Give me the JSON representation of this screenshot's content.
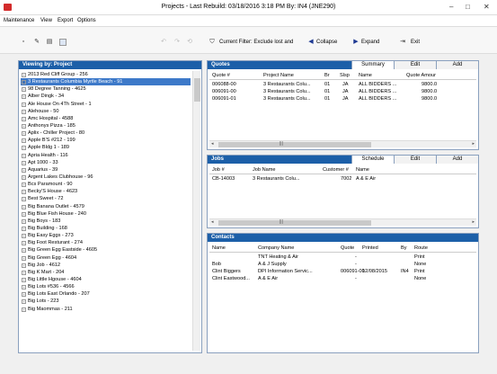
{
  "window": {
    "title": "Projects - Last Rebuild: 03/18/2016 3:18 PM By: IN4 (JNE290)",
    "minimize": "–",
    "maximize": "□",
    "close": "✕"
  },
  "menu": [
    "Maintenance",
    "View",
    "Export",
    "Options"
  ],
  "toolbar": {
    "current_filter": "Current Filter: Exclude lost and",
    "collapse": "Collapse",
    "expand": "Expand",
    "exit": "Exit"
  },
  "left_panel": {
    "title": "Viewing by: Project",
    "items": [
      "2013 Red Cliff Group - 256",
      "3 Restaurants Columbia Myrtle Beach - 91",
      "98 Degree Tanning - 4625",
      "Alber Dingk - 34",
      "Ale House On 4Th Street - 1",
      "Alehouse - 50",
      "Amc Hospital - 4588",
      "Anthonys Pizza - 185",
      "Aplix - Chiller Project - 80",
      "Apple B'S #212 - 199",
      "Apple Bldg 1 - 189",
      "Apria Health - 116",
      "Apt 1000 - 33",
      "Aquarius - 39",
      "Argent Lakes Clubhouse - 96",
      "Bcs Paramount - 90",
      "Becky'S House - 4623",
      "Best Sweet - 72",
      "Big Banana Outlet - 4579",
      "Big Blue Fish House - 240",
      "Big Boys - 183",
      "Big Building - 168",
      "Big Easy Eggs - 273",
      "Big Foot Resturant - 274",
      "Big Green Egg Eastside - 4605",
      "Big Green Egg - 4604",
      "Big Job - 4612",
      "Big K Mart - 204",
      "Big Little Hgouse - 4604",
      "Big Lots #536 - 4566",
      "Big Lots East Orlando - 207",
      "Big Lots - 223",
      "Big Maommas - 211"
    ]
  },
  "quotes": {
    "title": "Quotes",
    "tabs": [
      "Summary",
      "Edit",
      "Add"
    ],
    "columns": [
      "Quote #",
      "Project Name",
      "Br",
      "Slsp",
      "Name",
      "Quote Amour"
    ],
    "rows": [
      [
        "006088-00",
        "3 Restaurants Colu...",
        "01",
        "JA",
        "ALL BIDDERS ...",
        "9800.0"
      ],
      [
        "006091-00",
        "3 Restaurants Colu...",
        "01",
        "JA",
        "ALL BIDDERS ...",
        "9800.0"
      ],
      [
        "006091-01",
        "3 Restaurants Colu...",
        "01",
        "JA",
        "ALL BIDDERS ...",
        "9800.0"
      ]
    ]
  },
  "jobs": {
    "title": "Jobs",
    "tabs": [
      "Schedule",
      "Edit",
      "Add"
    ],
    "columns": [
      "Job #",
      "Job Name",
      "Customer #",
      "Name"
    ],
    "rows": [
      [
        "CB-14003",
        "3 Restaurants Colu...",
        "7002",
        "A & E Air"
      ]
    ]
  },
  "contacts": {
    "title": "Contacts",
    "columns": [
      "Name",
      "Company Name",
      "Quote",
      "Printed",
      "By",
      "Route"
    ],
    "rows": [
      [
        "",
        "TNT Heating & Air",
        "-",
        "",
        "",
        "Print"
      ],
      [
        "Bob",
        "A & J Supply",
        "-",
        "",
        "",
        "None"
      ],
      [
        "Clint Biggers",
        "DPI Information Servic...",
        "006091-00",
        "12/08/2015",
        "IN4",
        "Print"
      ],
      [
        "Clint Eastwood...",
        "A & E Air",
        "-",
        "",
        "",
        "None"
      ]
    ]
  }
}
